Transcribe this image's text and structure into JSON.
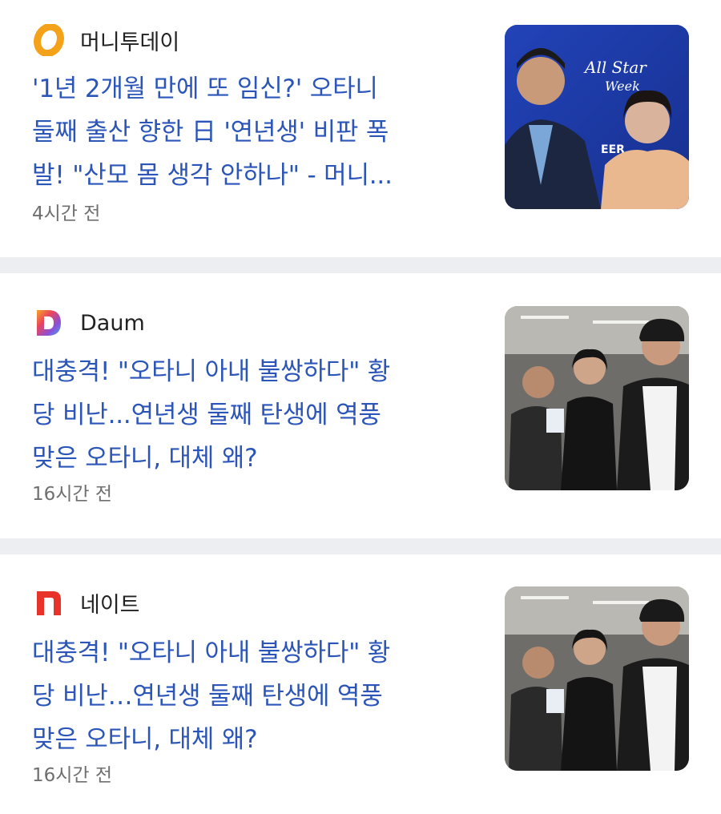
{
  "articles": [
    {
      "source": "머니투데이",
      "source_logo": "moneytoday-logo-icon",
      "headline_lines": [
        "'1년 2개월 만에 또 임신?' 오타니",
        "둘째 출산 향한 日 '연년생' 비판 폭",
        "발! \"산모 몸 생각 안하나\" - 머니..."
      ],
      "time": "4시간 전",
      "thumbnail": "allstar-couple-photo"
    },
    {
      "source": "Daum",
      "source_logo": "daum-logo-icon",
      "headline_lines": [
        "대충격! \"오타니 아내 불쌍하다\" 황",
        "당 비난...연년생 둘째 탄생에 역풍",
        "맞은 오타니, 대체 왜?"
      ],
      "time": "16시간 전",
      "thumbnail": "airport-couple-photo"
    },
    {
      "source": "네이트",
      "source_logo": "nate-logo-icon",
      "headline_lines": [
        "대충격! \"오타니 아내 불쌍하다\" 황",
        "당 비난…연년생 둘째 탄생에 역풍",
        "맞은 오타니, 대체 왜?"
      ],
      "time": "16시간 전",
      "thumbnail": "airport-couple-photo"
    }
  ],
  "colors": {
    "headline": "#2b55b8",
    "source_text": "#222222",
    "time_text": "#6f6f6f",
    "divider": "#eceef1",
    "moneytoday_orange": "#f5a21b",
    "nate_red": "#e8332a"
  }
}
